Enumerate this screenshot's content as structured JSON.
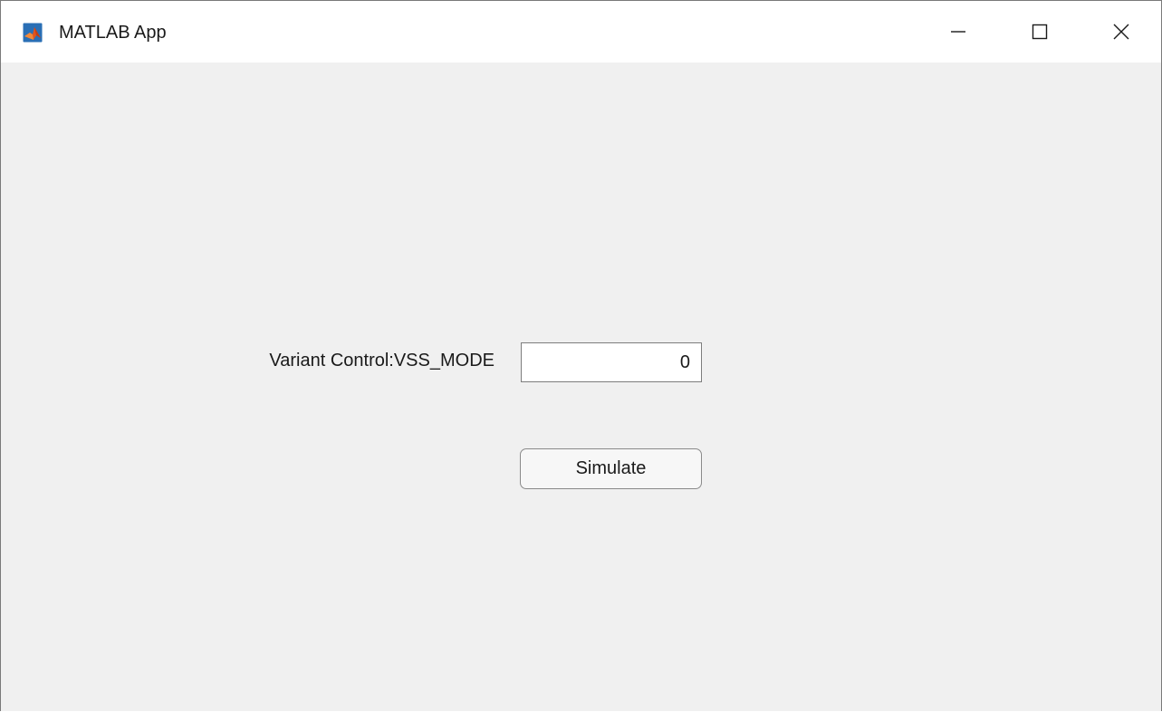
{
  "window": {
    "title": "MATLAB App",
    "icon": "matlab-logo-icon",
    "controls": {
      "minimize_icon": "minimize-icon",
      "maximize_icon": "maximize-icon",
      "close_icon": "close-icon"
    }
  },
  "form": {
    "variant_label": "Variant Control:VSS_MODE",
    "variant_value": "0",
    "simulate_label": "Simulate"
  },
  "colors": {
    "background": "#f0f0f0",
    "titlebar": "#ffffff",
    "input_border": "#7d7d7d",
    "button_border": "#8a8a8a",
    "matlab_orange": "#e2541d",
    "matlab_blue": "#2a6fb5"
  }
}
